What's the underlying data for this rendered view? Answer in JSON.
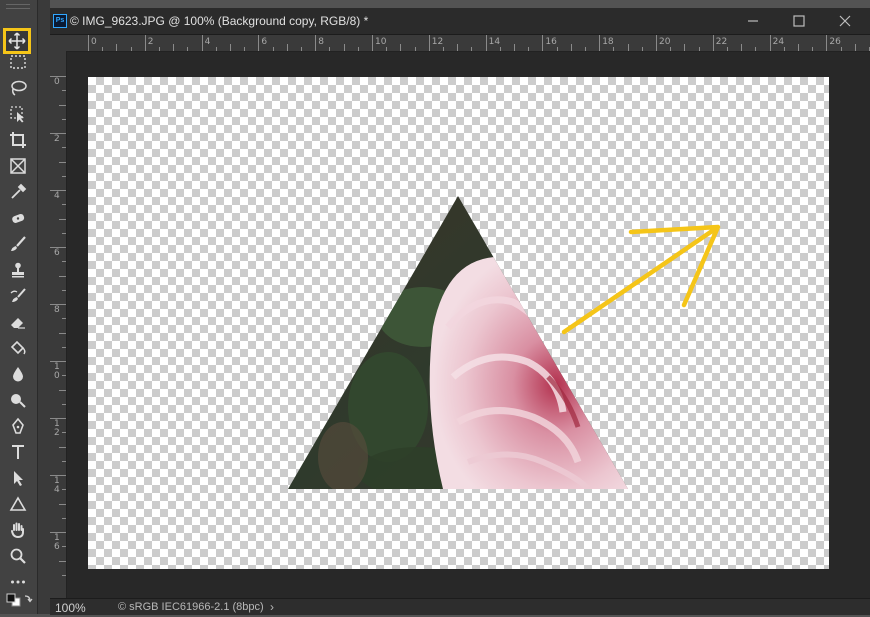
{
  "document": {
    "title": "© IMG_9623.JPG @ 100% (Background copy, RGB/8) *",
    "app_badge": "Ps"
  },
  "toolbar": {
    "tools": [
      "move-tool",
      "rectangular-marquee-tool",
      "lasso-tool",
      "object-selection-tool",
      "crop-tool",
      "frame-tool",
      "eyedropper-tool",
      "spot-healing-brush-tool",
      "brush-tool",
      "clone-stamp-tool",
      "history-brush-tool",
      "eraser-tool",
      "paint-bucket-tool",
      "blur-tool",
      "dodge-tool",
      "pen-tool",
      "type-tool",
      "path-selection-tool",
      "shape-tool",
      "hand-tool",
      "zoom-tool",
      "edit-toolbar"
    ],
    "active_tool": "move-tool",
    "highlight_color": "#f5c518"
  },
  "rulers": {
    "horizontal_labels": [
      "0",
      "2",
      "4",
      "6",
      "8",
      "10",
      "12",
      "14",
      "16",
      "18",
      "20",
      "22",
      "24",
      "26"
    ],
    "vertical_labels": [
      "0",
      "2",
      "4",
      "6",
      "8",
      "10",
      "12",
      "14",
      "16"
    ]
  },
  "annotation": {
    "arrow_color": "#f5c518"
  },
  "status": {
    "zoom": "100%",
    "profile": "© sRGB IEC61966-2.1 (8bpc)",
    "more_arrow": "›"
  }
}
